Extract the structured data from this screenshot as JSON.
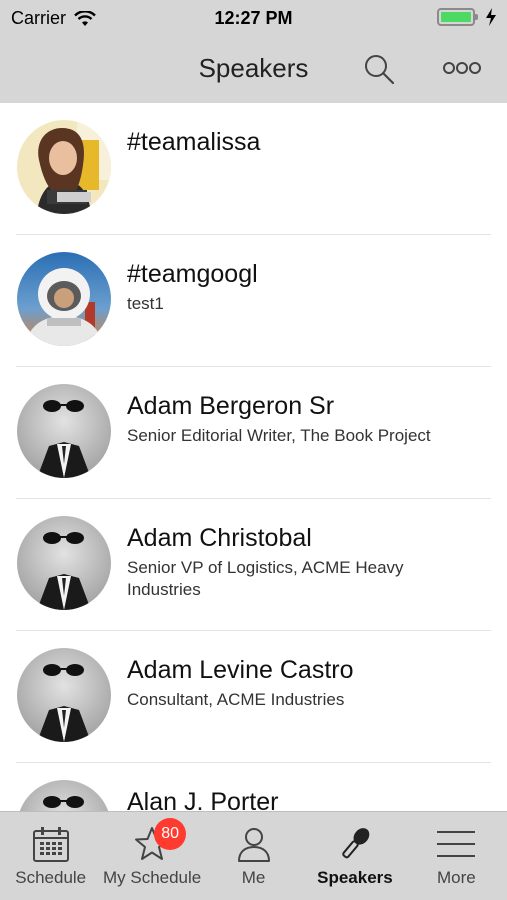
{
  "status_bar": {
    "carrier": "Carrier",
    "time": "12:27 PM"
  },
  "nav": {
    "title": "Speakers"
  },
  "speakers": [
    {
      "name": "#teamalissa",
      "subtitle": "",
      "avatar": "photo-woman"
    },
    {
      "name": "#teamgoogl",
      "subtitle": "test1",
      "avatar": "photo-astronaut"
    },
    {
      "name": "Adam Bergeron Sr",
      "subtitle": "Senior Editorial Writer, The Book Project",
      "avatar": "placeholder-man"
    },
    {
      "name": "Adam Christobal",
      "subtitle": "Senior VP of Logistics, ACME Heavy Industries",
      "avatar": "placeholder-man"
    },
    {
      "name": "Adam Levine Castro",
      "subtitle": "Consultant, ACME Industries",
      "avatar": "placeholder-man"
    },
    {
      "name": "Alan J. Porter",
      "subtitle": "",
      "avatar": "placeholder-man"
    }
  ],
  "tabs": [
    {
      "label": "Schedule",
      "icon": "calendar-icon"
    },
    {
      "label": "My Schedule",
      "icon": "star-icon",
      "badge": "80"
    },
    {
      "label": "Me",
      "icon": "person-icon"
    },
    {
      "label": "Speakers",
      "icon": "microphone-icon",
      "active": true
    },
    {
      "label": "More",
      "icon": "menu-icon"
    }
  ],
  "colors": {
    "bar_background": "#d6d6d6",
    "badge": "#ff3b30",
    "battery": "#4cd964"
  }
}
